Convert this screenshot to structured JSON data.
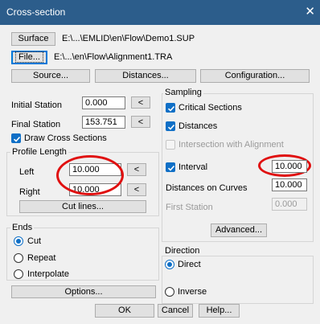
{
  "window": {
    "title": "Cross-section",
    "close_glyph": "✕"
  },
  "files": {
    "surface_button": "Surface",
    "surface_path": "E:\\...\\EMLID\\en\\Flow\\Demo1.SUP",
    "file_button": "File...",
    "file_path": "E:\\...\\en\\Flow\\Alignment1.TRA"
  },
  "tabs_row": {
    "source": "Source...",
    "distances": "Distances...",
    "configuration": "Configuration..."
  },
  "stations": {
    "initial_label": "Initial Station",
    "initial_value": "0.000",
    "final_label": "Final Station",
    "final_value": "153.751",
    "pick_glyph": "<"
  },
  "draw_cross_sections": {
    "label": "Draw Cross Sections",
    "checked": true
  },
  "profile_length": {
    "title": "Profile Length",
    "left_label": "Left",
    "left_value": "10.000",
    "right_label": "Right",
    "right_value": "10.000",
    "cut_lines_button": "Cut lines..."
  },
  "ends": {
    "title": "Ends",
    "options": [
      "Cut",
      "Repeat",
      "Interpolate"
    ],
    "selected": "Cut"
  },
  "options_button": "Options...",
  "sampling": {
    "title": "Sampling",
    "critical_sections": "Critical Sections",
    "distances": "Distances",
    "intersection": "Intersection with Alignment",
    "interval_label": "Interval",
    "interval_value": "10.000",
    "distances_on_curves_label": "Distances on Curves",
    "distances_on_curves_value": "10.000",
    "first_station_label": "First Station",
    "first_station_value": "0.000",
    "advanced_button": "Advanced..."
  },
  "direction": {
    "title": "Direction",
    "options": [
      "Direct",
      "Inverse"
    ],
    "selected": "Direct"
  },
  "footer": {
    "ok": "OK",
    "cancel": "Cancel",
    "help": "Help..."
  },
  "colors": {
    "titlebar": "#2c5d8b",
    "accent": "#0f6fc6",
    "highlight_ellipse": "#e01010"
  }
}
